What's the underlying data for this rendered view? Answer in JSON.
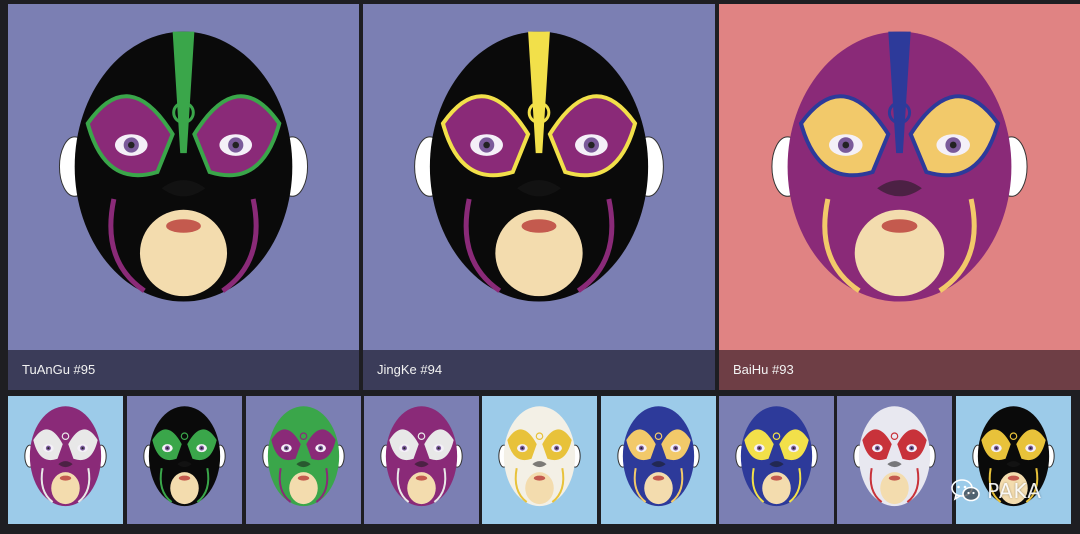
{
  "featured": [
    {
      "caption": "TuAnGu #95",
      "bg": "#7b7fb3",
      "caption_bg": "#3b3c59",
      "face": "#0a0a0a",
      "accent": "#8a2a78",
      "stripe": "#3aa64a"
    },
    {
      "caption": "JingKe #94",
      "bg": "#7b7fb3",
      "caption_bg": "#3b3c59",
      "face": "#0a0a0a",
      "accent": "#8a2a78",
      "stripe": "#f2e04a"
    },
    {
      "caption": "BaiHu #93",
      "bg": "#e08383",
      "caption_bg": "#6e3e45",
      "face": "#8a2a78",
      "accent": "#f2c96a",
      "stripe": "#2d3a9a"
    }
  ],
  "thumbnails": [
    {
      "bg": "#9ccbe9",
      "face": "#8a2a78",
      "accent": "#e8e8e8"
    },
    {
      "bg": "#7b7fb3",
      "face": "#0a0a0a",
      "accent": "#3aa64a"
    },
    {
      "bg": "#7b7fb3",
      "face": "#3aa64a",
      "accent": "#8a2a78"
    },
    {
      "bg": "#7b7fb3",
      "face": "#8a2a78",
      "accent": "#e8e8e8"
    },
    {
      "bg": "#9ccbe9",
      "face": "#f3f0e6",
      "accent": "#e8c23a"
    },
    {
      "bg": "#9ccbe9",
      "face": "#2d3a9a",
      "accent": "#f2c96a"
    },
    {
      "bg": "#7b7fb3",
      "face": "#2d3a9a",
      "accent": "#f2e04a"
    },
    {
      "bg": "#7b7fb3",
      "face": "#e8e8f0",
      "accent": "#c8323a"
    },
    {
      "bg": "#9ccbe9",
      "face": "#0a0a0a",
      "accent": "#e8c23a"
    }
  ],
  "watermark": {
    "text": "PAKA",
    "icon": "wechat-icon"
  }
}
